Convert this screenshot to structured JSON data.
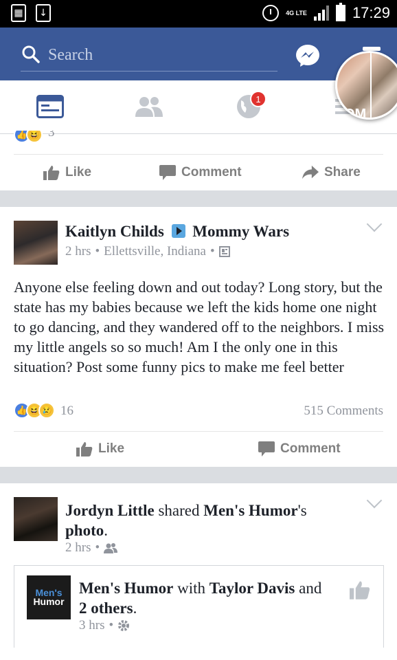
{
  "status_bar": {
    "network": "4G LTE",
    "time": "17:29"
  },
  "header": {
    "search_placeholder": "Search"
  },
  "tabs": {
    "notifications_badge": "1",
    "more_label_fragment": "OM"
  },
  "prev_post": {
    "reaction_count": "3",
    "like_label": "Like",
    "comment_label": "Comment",
    "share_label": "Share"
  },
  "post1": {
    "author": "Kaitlyn Childs",
    "group": "Mommy Wars",
    "time": "2 hrs",
    "location": "Ellettsville, Indiana",
    "text": "Anyone else feeling down and out today? Long story, but the state has my babies because we left the kids home one night to go dancing, and they wandered off to the neighbors. I miss my little angels so so much! Am I the only one in this situation? Post some funny pics to make me feel better",
    "reaction_count": "16",
    "comments_count": "515 Comments",
    "like_label": "Like",
    "comment_label": "Comment"
  },
  "post2": {
    "author": "Jordyn Little",
    "shared_text": "shared",
    "page": "Men's Humor",
    "possessive": "'s",
    "object": "photo",
    "period": ".",
    "time": "2 hrs",
    "shared": {
      "logo_line1": "Men's",
      "logo_line2": "Humor",
      "page": "Men's Humor",
      "with": "with",
      "tagged": "Taylor Davis",
      "and": "and",
      "others": "2 others",
      "period": ".",
      "time": "3 hrs"
    }
  },
  "colors": {
    "brand_blue": "#3b5998",
    "badge_red": "#e0332f",
    "like_blue": "#4a7fe0",
    "muted_text": "#90949c"
  }
}
